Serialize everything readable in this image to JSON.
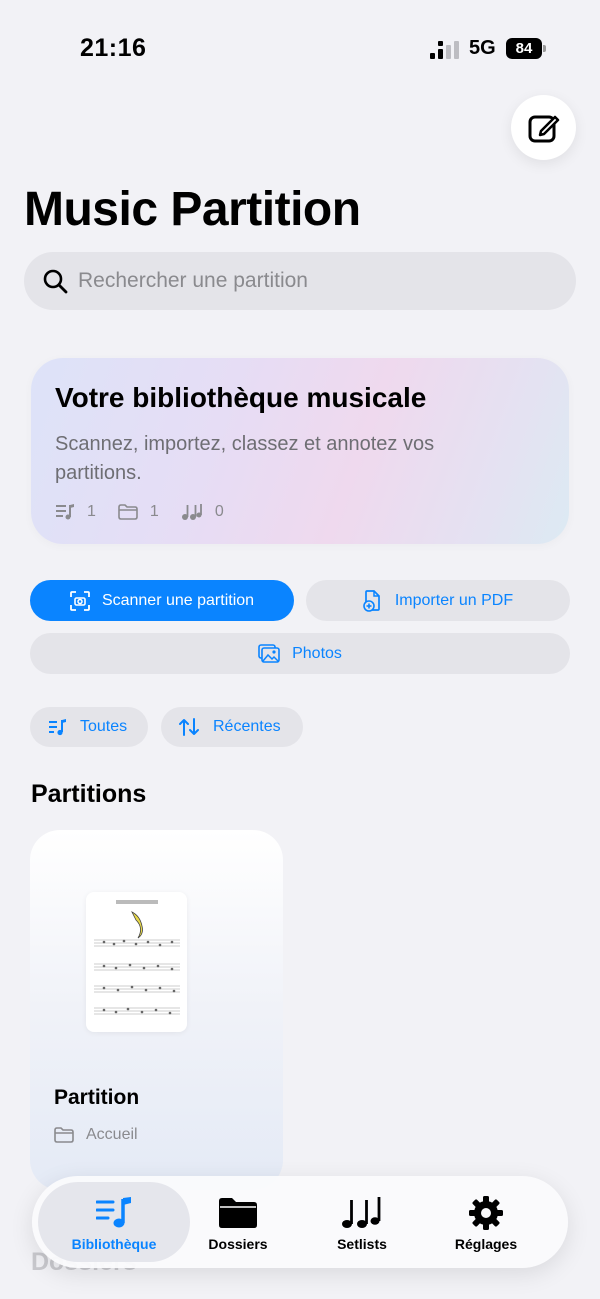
{
  "status_bar": {
    "time": "21:16",
    "network": "5G",
    "battery": "84"
  },
  "header": {
    "title": "Music Partition",
    "compose_icon": "compose-icon"
  },
  "search": {
    "placeholder": "Rechercher une partition",
    "value": ""
  },
  "hero": {
    "title": "Votre bibliothèque musicale",
    "subtitle": "Scannez, importez, classez et annotez vos partitions.",
    "stats": {
      "partitions": "1",
      "folders": "1",
      "setlists": "0"
    }
  },
  "actions": {
    "scan_label": "Scanner une partition",
    "import_label": "Importer un PDF",
    "photos_label": "Photos"
  },
  "filters": {
    "all_label": "Toutes",
    "recent_label": "Récentes"
  },
  "partitions": {
    "section_title": "Partitions",
    "items": [
      {
        "name": "Partition",
        "folder": "Accueil"
      }
    ]
  },
  "dossiers": {
    "section_title": "Dossiers"
  },
  "tabbar": {
    "library": "Bibliothèque",
    "folders": "Dossiers",
    "setlists": "Setlists",
    "settings": "Réglages"
  },
  "colors": {
    "accent": "#0A84FF",
    "background": "#F2F2F6",
    "chip": "#E4E4E9"
  }
}
